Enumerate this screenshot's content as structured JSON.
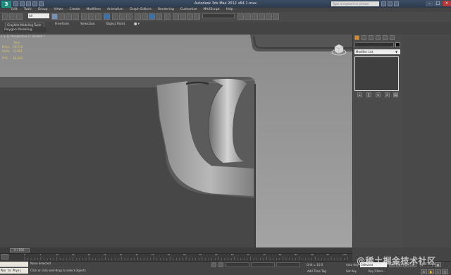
{
  "window": {
    "title": "Autodesk 3ds Max 2012 x64   1.max",
    "search_placeholder": "Type a keyword or phrase",
    "app_logo": "3"
  },
  "menu": [
    "Edit",
    "Tools",
    "Group",
    "Views",
    "Create",
    "Modifiers",
    "Animation",
    "Graph Editors",
    "Rendering",
    "Customize",
    "MAXScript",
    "Help"
  ],
  "toolbar": {
    "view_dropdown": "All",
    "selection_set": ""
  },
  "ribbon": {
    "tabs": [
      "Graphite Modeling Tools",
      "Freeform",
      "Selection",
      "Object Paint"
    ],
    "panel_label": "Polygon Modeling"
  },
  "viewport": {
    "label": "[ + ] [ Perspective ] [ Shaded ]",
    "stats_header": "Total",
    "stats": [
      {
        "label": "Polys:",
        "value": "28,510"
      },
      {
        "label": "Verts:",
        "value": "12,901"
      },
      {
        "label": "FPS:",
        "value": "30,028"
      }
    ],
    "colors": {
      "background": "#5c5c5c",
      "model_light": "#a9a9a9",
      "model_dark": "#444444"
    }
  },
  "command_panel": {
    "modifier_list": "Modifier List",
    "object_name": ""
  },
  "timeline": {
    "frame_label": "0 / 100",
    "ticks": [
      "0",
      "5",
      "10",
      "15",
      "20",
      "25",
      "30",
      "35",
      "40",
      "45",
      "50",
      "55",
      "60",
      "65",
      "70",
      "75",
      "80",
      "85",
      "90",
      "95",
      "100"
    ]
  },
  "status": {
    "maxscript_text": "Max to Physc",
    "selection_message": "None Selected",
    "prompt": "Click or click-and-drag to select objects",
    "grid": "Grid = 10.0",
    "add_time_tag": "Add Time Tag",
    "auto_key": "Auto Key",
    "auto_key_mode": "Selected",
    "set_key": "Set Key",
    "key_filters": "Key Filters...",
    "current_frame": "0"
  },
  "watermark": "@稀土掘金技术社区"
}
